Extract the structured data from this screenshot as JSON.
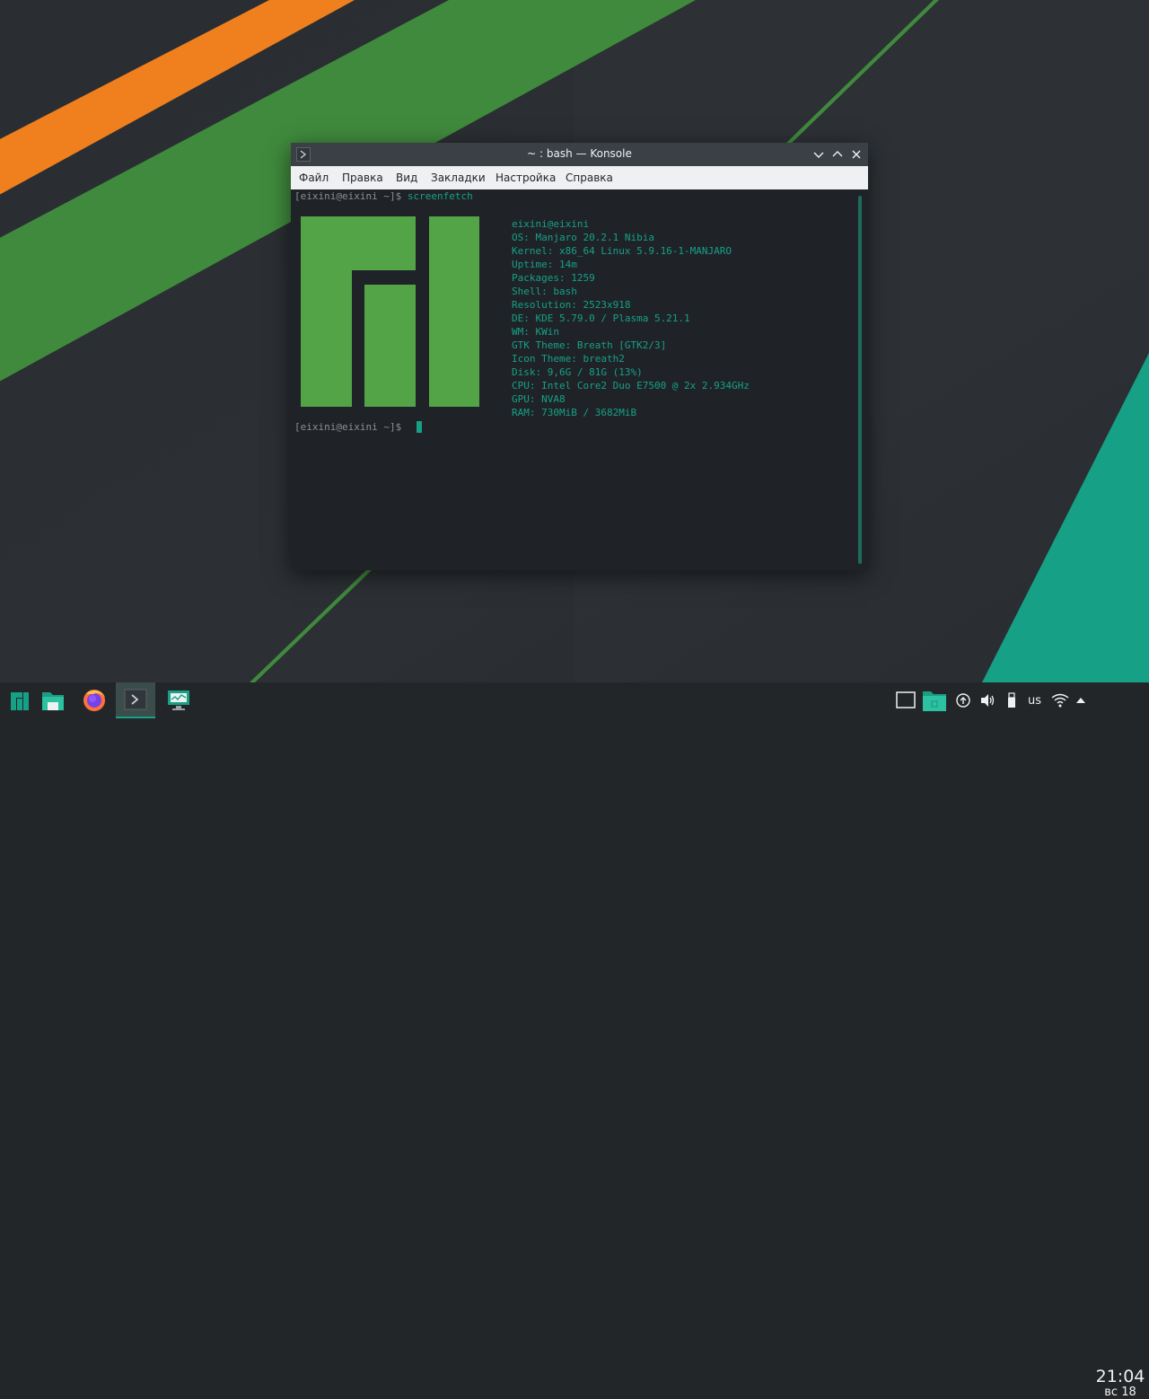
{
  "window": {
    "title": "~ : bash — Konsole",
    "menu": [
      "Файл",
      "Правка",
      "Вид",
      "Закладки",
      "Настройка",
      "Справка"
    ]
  },
  "terminal": {
    "prompt1": "[eixini@eixini ~]$",
    "command1": " screenfetch",
    "prompt2": "[eixini@eixini ~]$",
    "info": [
      "eixini@eixini",
      "OS: Manjaro 20.2.1 Nibia",
      "Kernel: x86_64 Linux 5.9.16-1-MANJARO",
      "Uptime: 14m",
      "Packages: 1259",
      "Shell: bash",
      "Resolution: 2523x918",
      "DE: KDE 5.79.0 / Plasma 5.21.1",
      "WM: KWin",
      "GTK Theme: Breath [GTK2/3]",
      "Icon Theme: breath2",
      "Disk: 9,6G / 81G (13%)",
      "CPU: Intel Core2 Duo E7500 @ 2x 2.934GHz",
      "GPU: NVA8",
      "RAM: 730MiB / 3682MiB"
    ]
  },
  "taskbar": {
    "apps": [
      "manjaro-menu-icon",
      "file-manager-icon",
      "firefox-icon",
      "konsole-icon",
      "system-monitor-icon"
    ],
    "keyboard_layout": "us",
    "clock_time": "21:04",
    "clock_date": "вс 18"
  },
  "colors": {
    "accent": "#16a085",
    "logo_green": "#52a447",
    "orange": "#f0801e"
  }
}
